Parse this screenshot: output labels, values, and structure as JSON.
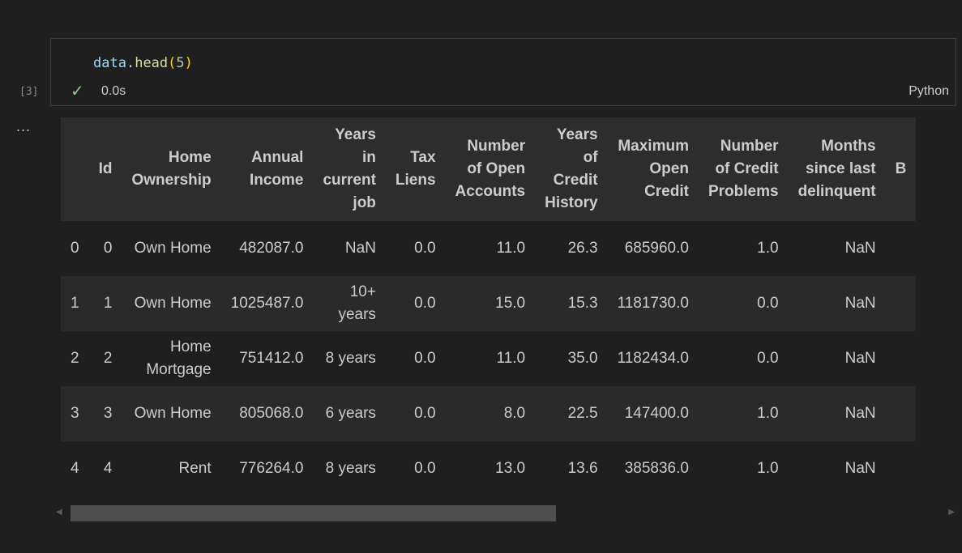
{
  "cell": {
    "execution_count": "[3]",
    "code": {
      "var": "data",
      "dot": ".",
      "fn": "head",
      "open": "(",
      "arg": "5",
      "close": ")"
    },
    "status_time": "0.0s",
    "language": "Python",
    "output_menu": "..."
  },
  "dataframe": {
    "columns": [
      "",
      "Id",
      "Home Ownership",
      "Annual Income",
      "Years in current job",
      "Tax Liens",
      "Number of Open Accounts",
      "Years of Credit History",
      "Maximum Open Credit",
      "Number of Credit Problems",
      "Months since last delinquent",
      "B"
    ],
    "rows": [
      [
        "0",
        "0",
        "Own Home",
        "482087.0",
        "NaN",
        "0.0",
        "11.0",
        "26.3",
        "685960.0",
        "1.0",
        "NaN",
        ""
      ],
      [
        "1",
        "1",
        "Own Home",
        "1025487.0",
        "10+ years",
        "0.0",
        "15.0",
        "15.3",
        "1181730.0",
        "0.0",
        "NaN",
        ""
      ],
      [
        "2",
        "2",
        "Home Mortgage",
        "751412.0",
        "8 years",
        "0.0",
        "11.0",
        "35.0",
        "1182434.0",
        "0.0",
        "NaN",
        ""
      ],
      [
        "3",
        "3",
        "Own Home",
        "805068.0",
        "6 years",
        "0.0",
        "8.0",
        "22.5",
        "147400.0",
        "1.0",
        "NaN",
        ""
      ],
      [
        "4",
        "4",
        "Rent",
        "776264.0",
        "8 years",
        "0.0",
        "13.0",
        "13.6",
        "385836.0",
        "1.0",
        "NaN",
        ""
      ]
    ]
  },
  "scrollbar": {
    "position_fraction": 0.0,
    "visible_fraction": 0.54
  },
  "icons": {
    "status": "check-icon",
    "scroll_left": "scroll-left-arrow-icon",
    "scroll_right": "scroll-right-arrow-icon"
  },
  "colors": {
    "background": "#1f1f1f",
    "header_bg": "#2d2d2d",
    "check": "#89d185"
  }
}
